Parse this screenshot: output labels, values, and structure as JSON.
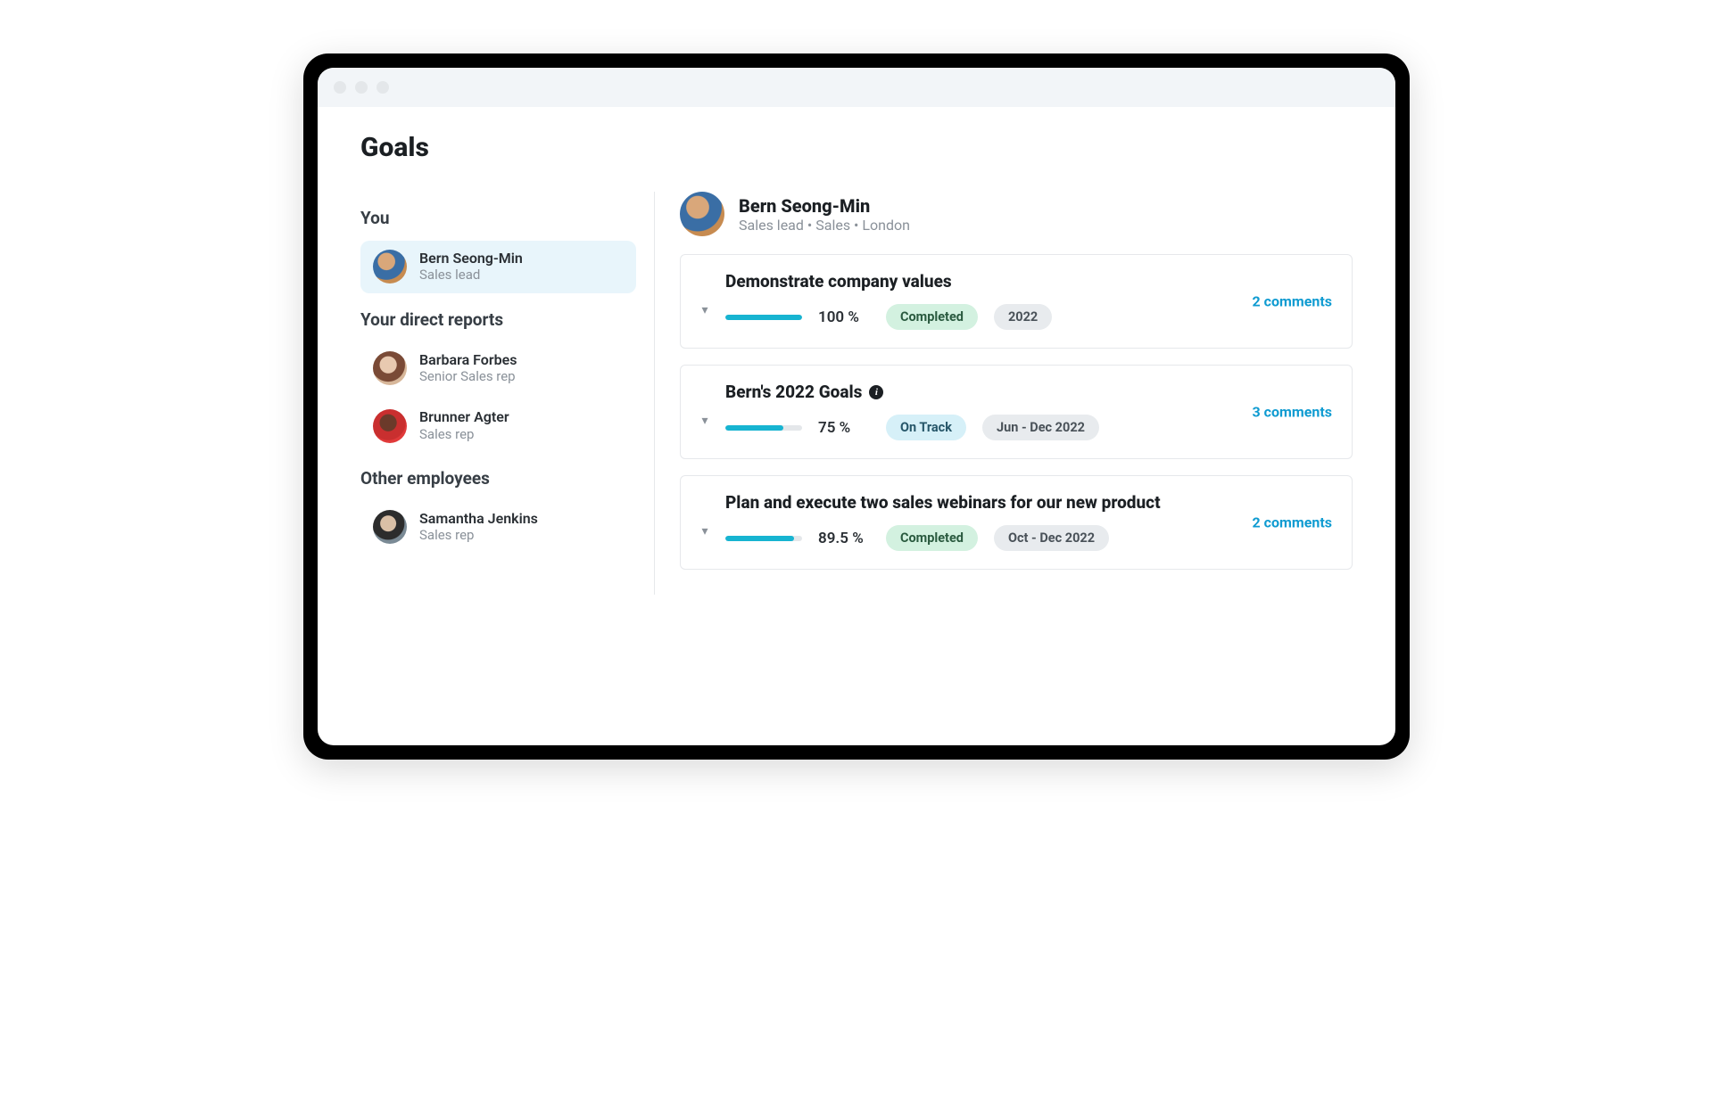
{
  "page_title": "Goals",
  "sidebar": {
    "sections": {
      "you": {
        "heading": "You",
        "person": {
          "name": "Bern Seong-Min",
          "role": "Sales lead",
          "avatar": "av-bern",
          "selected": true
        }
      },
      "direct_reports": {
        "heading": "Your direct reports",
        "people": [
          {
            "name": "Barbara Forbes",
            "role": "Senior Sales rep",
            "avatar": "av-barbara"
          },
          {
            "name": "Brunner Agter",
            "role": "Sales rep",
            "avatar": "av-brunner"
          }
        ]
      },
      "other": {
        "heading": "Other employees",
        "people": [
          {
            "name": "Samantha Jenkins",
            "role": "Sales rep",
            "avatar": "av-sam"
          }
        ]
      }
    }
  },
  "profile": {
    "name": "Bern Seong-Min",
    "meta": "Sales lead • Sales • London",
    "avatar": "av-bern"
  },
  "goals": [
    {
      "title": "Demonstrate company values",
      "has_info": false,
      "percent_text": "100 %",
      "percent_value": 100,
      "status": {
        "label": "Completed",
        "kind": "completed"
      },
      "date_label": "2022",
      "comments_text": "2 comments"
    },
    {
      "title": "Bern's 2022 Goals",
      "has_info": true,
      "percent_text": "75 %",
      "percent_value": 75,
      "status": {
        "label": "On Track",
        "kind": "ontrack"
      },
      "date_label": "Jun - Dec 2022",
      "comments_text": "3 comments"
    },
    {
      "title": "Plan and execute two sales webinars for our new product",
      "has_info": false,
      "percent_text": "89.5 %",
      "percent_value": 89.5,
      "status": {
        "label": "Completed",
        "kind": "completed"
      },
      "date_label": "Oct - Dec 2022",
      "comments_text": "2 comments"
    }
  ]
}
